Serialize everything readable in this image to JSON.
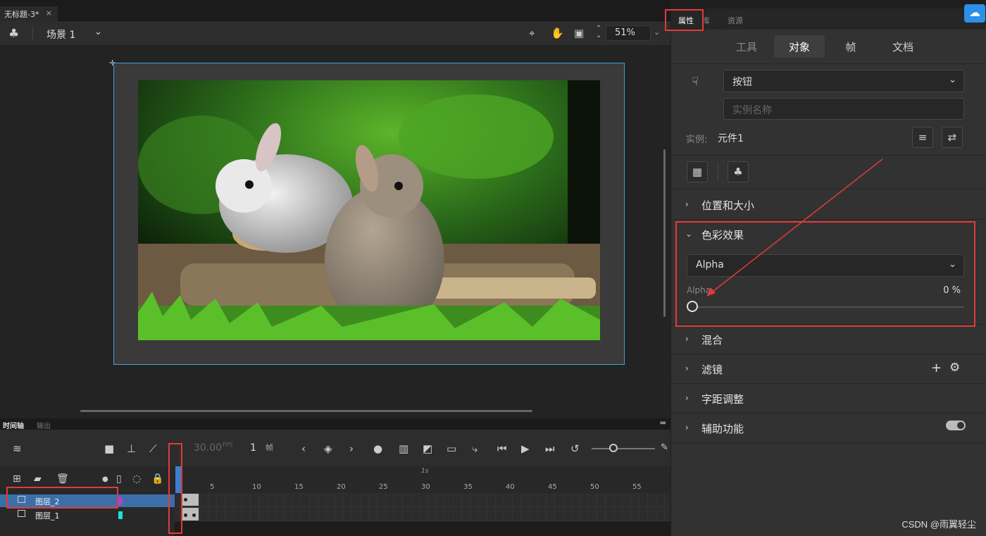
{
  "document": {
    "tab_title": "无标题-3*",
    "close_glyph": "×"
  },
  "stage_toolbar": {
    "scene_label": "场景 1",
    "zoom": "51%",
    "icons": [
      "scene-icon",
      "crosshair-icon",
      "hand-icon",
      "clip-icon",
      "zoom-stepper-icon"
    ]
  },
  "timeline": {
    "tabs": [
      "时间轴",
      "输出"
    ],
    "fps": "30.00",
    "fps_unit": "FPS",
    "frame": "1",
    "frame_unit": "帧",
    "ruler_seconds": "1s",
    "ruler_numbers": [
      "5",
      "10",
      "15",
      "20",
      "25",
      "30",
      "35",
      "40",
      "45",
      "50",
      "55"
    ],
    "layers": [
      {
        "name": "图层_2",
        "selected": true,
        "color": "#b040d0"
      },
      {
        "name": "图层_1",
        "selected": false,
        "color": "#20e0e0"
      }
    ]
  },
  "properties": {
    "tabs": [
      "属性",
      "库",
      "资源"
    ],
    "subtabs": [
      "工具",
      "对象",
      "帧",
      "文档"
    ],
    "active_subtab": "对象",
    "symbol_type": "按钮",
    "instance_name_placeholder": "实例名称",
    "instance_label": "实例:",
    "instance_value": "元件1",
    "sections": {
      "position_size": "位置和大小",
      "color_effect": "色彩效果",
      "blend": "混合",
      "filters": "滤镜",
      "kerning": "字距调整",
      "accessibility": "辅助功能"
    },
    "color_effect_style": "Alpha",
    "alpha_label": "Alpha",
    "alpha_value": "0 %",
    "filters_add": "+",
    "filters_gear": "⚙"
  },
  "watermark": "CSDN @雨翼轻尘",
  "colors": {
    "accent": "#3c7ed0",
    "highlight": "#e23a3a",
    "stage_border": "#3ea0d8"
  }
}
